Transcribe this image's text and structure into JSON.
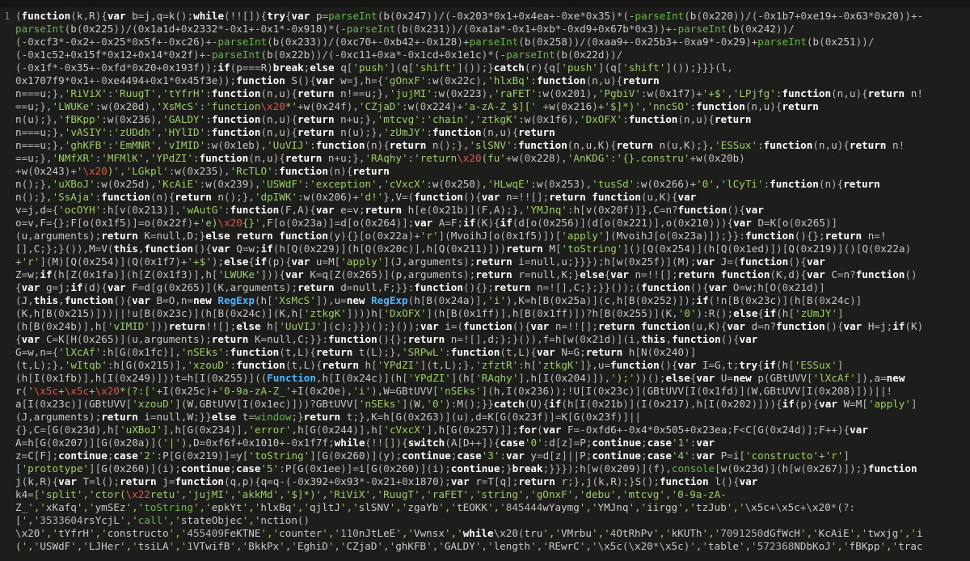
{
  "editor": {
    "line_number": "1",
    "colors": {
      "background": "#1d1d1b",
      "keyword": "#ffffff",
      "string": "#9dcf64",
      "function_green": "#69b54d",
      "regexp_blue": "#4fb4ff",
      "escape_red": "#e0564e",
      "plain": "#c9c9c9"
    },
    "lines": [
      "(function(k,R){var b=j,q=k();while(!![]){try{var p=parseInt(b(0x247))/(-0x203*0x1+0x4ea+-0xe*0x35)*(-parseInt(b(0x220))/(-0x1b7+0xe19+-0x63*0x20))+-",
      "parseInt(b(0x225))/(0x1a1d+0x2332*-0x1+-0x1*-0x918)*(-parseInt(b(0x231))/(0xa1a*-0x1+0xb*-0xd9+0x67b*0x3))+-parseInt(b(0x242))/",
      "(-0xcf3*-0x2+-0x25*0x5f+-0xc26)+-parseInt(b(0x233))/(0xc70+-0xb42+-0x128)+parseInt(b(0x258))/(0xaa9+-0x25b3+-0xa9*-0x29)+parseInt(b(0x251))/",
      "(-0x1c52+0x15f*0x12+0x14*0x2f)+-parseInt(b(0x22b))/(-0xc11+0xa*-0x1cd+0x1e1c)*(-parseInt(b(0x22d))/",
      "(-0x1f*-0x35+-0xfd*0x20+0x193f));if(p===R)break;else q['push'](q['shift']());}catch(r){q['push'](q['shift']());}}}(l,",
      "0x1707f9*0x1+-0xe4494+0x1*0x45f3e));function S(){var w=j,h={'gOnxF':w(0x22c),'hlxBq':function(n,u){return",
      "n===u;},'RiViX':'RuugT','tYfrH':function(n,u){return n!==u;},'jujMI':w(0x223),'raFET':w(0x201),'PgbiV':w(0x1f7)+'+$','LPjfg':function(n,u){return n!",
      "==u;},'LWUKe':w(0x20d),'XsMcS':'function\\x20*'+w(0x24f),'CZjaD':w(0x224)+'a-zA-Z_$][' +w(0x216)+'$]*)','nncSO':function(n,u){return",
      "n(u);},'fBKpp':w(0x236),'GALDY':function(n,u){return n+u;},'mtcvg':'chain','ztkgK':w(0x1f6),'DxOFX':function(n,u){return",
      "n===u;},'vASIY':'zUDdh','HYlID':function(n,u){return n(u);},'zUmJY':function(n,u){return",
      "n===u;},'ghKFB':'EmMNR','vIMID':w(0x1eb),'UuVIJ':function(n){return n();},'slSNV':function(n,u,K){return n(u,K);},'ESSux':function(n,u){return n!",
      "==u;},'NMfXR':'MFMlK','YPdZI':function(n,u){return n+u;},'RAqhy':'return\\x20(fu'+w(0x228),'AnKDG':'{}.constru'+w(0x20b)",
      "+w(0x243)+'\\x20)','LGkpl':w(0x235),'RcTLO':function(n){return",
      "n();},'uXBoJ':w(0x25d),'KcAiE':w(0x239),'USWdF':'exception','cVxcX':w(0x250),'HLwqE':w(0x253),'tusSd':w(0x266)+'0','lCyTi':function(n){return",
      "n();},'SsAja':function(n){return n();},'dpIWK':w(0x206)+'d!'},V=(function(){var n=!![];return function(u,K){var",
      "v=j,d={'ocOYH':h[v(0x213)],'wAutG':function(F,A){var e=v;return h[e(0x21b)](F,A);},'YMJnq':h[v(0x20f)]},C=n?function(){var",
      "o=v,F={};F[o(0x1f5)]=o(0x22f)+'e)\\x20{}',F[o(0x23a)]=d[o(0x264)];var A=F;if(K){if(d[o(0x256)](d[o(0x221)],o(0x210))){var D=K[o(0x265)]",
      "(u,arguments);return K=null,D;}else return function(y){}[o(0x22a)+'r'](MvoihJ[o(0x1f5)])['apply'](MvoihJ[o(0x23a)]);}}:function(){};return n=!",
      "[],C;};}()),M=V(this,function(){var Q=w;if(h[Q(0x229)](h[Q(0x20c)],h[Q(0x211)]))return M['toString']()[Q(0x254)](h[Q(0x1ed)])[Q(0x219)]()[Q(0x22a)",
      "+'r'](M)[Q(0x254)](Q(0x1f7)+'+$');else{if(p){var u=M['apply'](J,arguments);return i=null,u;}}});h[w(0x25f)](M);var J=(function(){var",
      "Z=w;if(h[Z(0x1fa)](h[Z(0x1f3)],h['LWUKe'])){var K=q[Z(0x265)](p,arguments);return r=null,K;}else{var n=!![];return function(K,d){var C=n?function()",
      "{var g=j;if(d){var F=d[g(0x265)](K,arguments);return d=null,F;}}:function(){};return n=![],C;};}}());(function(){var O=w;h[O(0x21d)]",
      "(J,this,function(){var B=O,n=new RegExp(h['XsMcS']),u=new RegExp(h[B(0x24a)],'i'),K=h[B(0x25a)](c,h[B(0x252)]);if(!n[B(0x23c)](h[B(0x24c)]",
      "(K,h[B(0x215)]))||!u[B(0x23c)](h[B(0x24c)](K,h['ztkgK'])))h['DxOFX'](h[B(0x1ff)],h[B(0x1ff)])?h[B(0x255)](K,'0'):R();else{if(h['zUmJY']",
      "(h[B(0x24b)],h['vIMID']))return!![];else h['UuVIJ'](c);}})();}());var i=(function(){var n=!![];return function(u,K){var d=n?function(){var H=j;if(K)",
      "{var C=K[H(0x265)](u,arguments);return K=null,C;}}:function(){};return n=![],d;};}()),f=h[w(0x21d)](i,this,function(){var",
      "G=w,n={'lXcAf':h[G(0x1fc)],'nSEks':function(t,L){return t(L);},'SRPwL':function(t,L){var N=G;return h[N(0x240)]",
      "(t,L);},'wItqb':h[G(0x215)],'xzouD':function(t,L){return h['YPdZI'](t,L);},'zfztR':h['ztkgK']},u=function(){var I=G,t;try{if(h['ESSux']",
      "(h[I(0x1fb)],h[I(0x249)]))t=h[I(0x255)]((Function,h[I(0x24c)](h['YPdZI'](h['RAqhy'],h[I(0x204)]),');'))();else{var U=new p(GBtUVV['lXcAf']),a=new",
      "r('\\x5c+\\x5c+\\x20*(?:['+I(0x25c)+'0-9a-zA-Z_'+I(0x20e),'i'),W=GBtUVV['nSEks'](h,I(0x236));!U[I(0x23c)](GBtUVV[I(0x1fd)](W,GBtUVV[I(0x208)]))||!",
      "a[I(0x23c)](GBtUVV['xzouD'](W,GBtUVV[I(0x1ec)]))?GBtUVV['nSEks'](W,'0'):M();}}catch(U){if(h[I(0x21b)](I(0x217),h[I(0x202)])){if(p){var W=M['apply']",
      "(J,arguments);return i=null,W;}}else t=window;}return t;},K=h[G(0x263)](u),d=K[G(0x23f)]=K[G(0x23f)]||",
      "{},C=[G(0x23d),h['uXBoJ'],h[G(0x234)],'error',h[G(0x244)],h['cVxcX'],h[G(0x257)]];for(var F=-0xfd6+-0x4*0x505+0x23ea;F<C[G(0x24d)];F++){var",
      "A=h[G(0x207)][G(0x20a)]('|'),D=0xf6f+0x1010+-0x1f7f;while(!![]){switch(A[D++]){case'0':d[z]=P;continue;case'1':var",
      "z=C[F];continue;case'2':P[G(0x219)]=y['toString'][G(0x260)](y);continue;case'3':var y=d[z]||P;continue;case'4':var P=i['constructo'+'r']",
      "['prototype'][G(0x260)](i);continue;case'5':P[G(0x1ee)]=i[G(0x260)](i);continue;}break;}}});h[w(0x209)](f),console[w(0x23d)](h[w(0x267)]);}function",
      "j(k,R){var T=l();return j=function(q,p){q=q-(-0x392+0x93*-0x21+0x1870);var r=T[q];return r;},j(k,R);}S();function l(){var",
      "k4=['split','ctor(\\x22retu','jujMI','akkMd','$]*)','RiViX','RuugT','raFET','string','gOnxF','debu','mtcvg','0-9a-zA-",
      "Z_','xKafq','ymSEz','toString','epkYt','hlxBq','qjltJ','slSNV','zgaYb','tEOKK','845444wYaymg','YMJnq','iirgg','tzJub','\\x5c+\\x5c+\\x20*(?:",
      "[','3533604rsYcjL','call','stateObjec','nction()",
      "\\x20','tYfrH','constructo','455409FeKTNE','counter','110nJtLeE','Vwnsx','while\\x20(tru','VMrbu','4OtRhPv','kKUTh','7091250dGfWcH','KcAiE','twxjg','i",
      "(','USWdF','LJHer','tsiLA','1VTwifB','BkkPx','EghiD','CZjaD','ghKFB','GALDY','length','REwrC','\\x5c(\\x20*\\x5c)','table','572368NDbKoJ','fBKpp','trac"
    ]
  }
}
